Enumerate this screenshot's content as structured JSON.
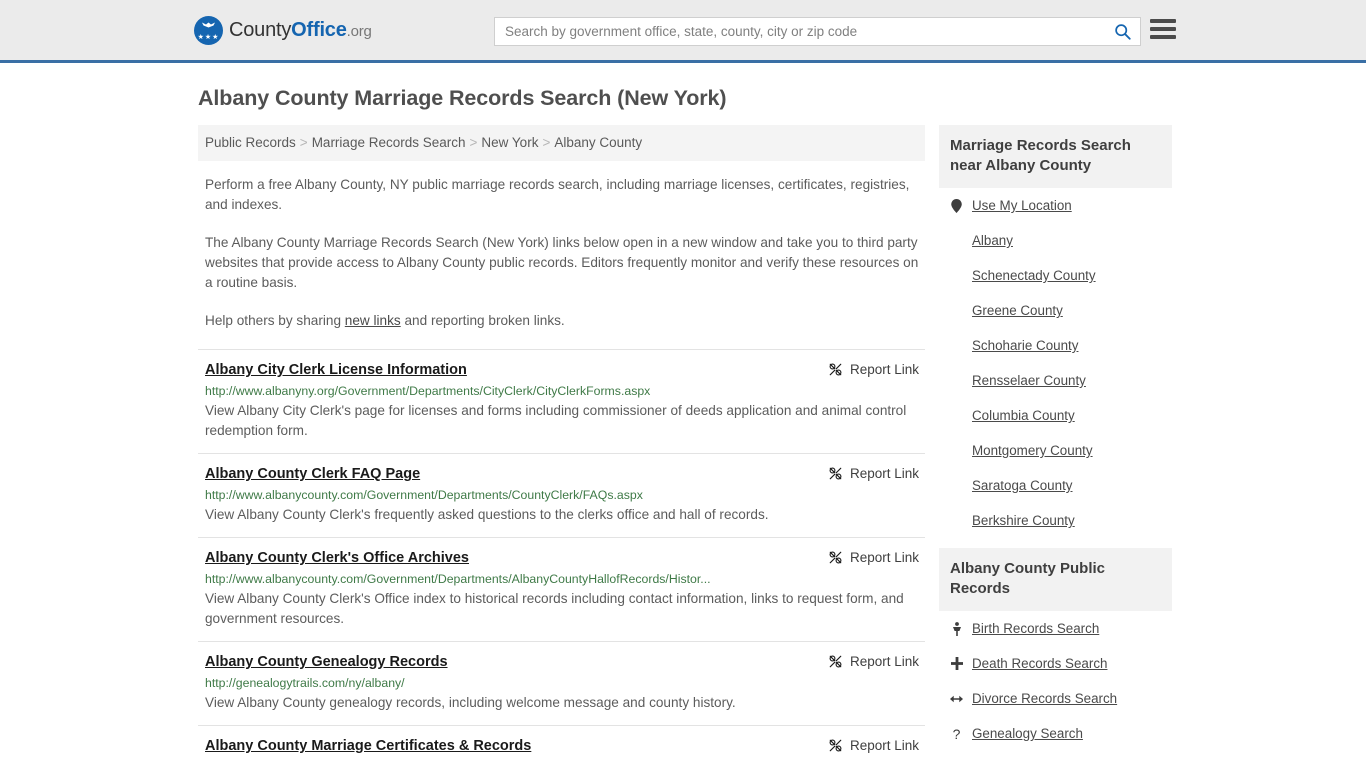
{
  "header": {
    "logo": {
      "part1": "County",
      "part2": "Office",
      "part3": ".org",
      "icon": "eagle-shield-logo"
    },
    "search": {
      "placeholder": "Search by government office, state, county, city or zip code",
      "value": "",
      "search_icon": "search-icon"
    },
    "menu_icon": "hamburger-menu-icon",
    "accent_color": "#3a6fa5"
  },
  "page_title": "Albany County Marriage Records Search (New York)",
  "breadcrumb": {
    "separator": ">",
    "items": [
      {
        "label": "Public Records"
      },
      {
        "label": "Marriage Records Search"
      },
      {
        "label": "New York"
      },
      {
        "label": "Albany County"
      }
    ]
  },
  "intro": {
    "p1": "Perform a free Albany County, NY public marriage records search, including marriage licenses, certificates, registries, and indexes.",
    "p2": "The Albany County Marriage Records Search (New York) links below open in a new window and take you to third party websites that provide access to Albany County public records. Editors frequently monitor and verify these resources on a routine basis.",
    "p3_before": "Help others by sharing ",
    "p3_link": "new links",
    "p3_after": " and reporting broken links."
  },
  "results": {
    "report_label": "Report Link",
    "report_icon": "broken-link-icon",
    "items": [
      {
        "title": "Albany City Clerk License Information",
        "url": "http://www.albanyny.org/Government/Departments/CityClerk/CityClerkForms.aspx",
        "description": "View Albany City Clerk's page for licenses and forms including commissioner of deeds application and animal control redemption form."
      },
      {
        "title": "Albany County Clerk FAQ Page",
        "url": "http://www.albanycounty.com/Government/Departments/CountyClerk/FAQs.aspx",
        "description": "View Albany County Clerk's frequently asked questions to the clerks office and hall of records."
      },
      {
        "title": "Albany County Clerk's Office Archives",
        "url": "http://www.albanycounty.com/Government/Departments/AlbanyCountyHallofRecords/Histor...",
        "description": "View Albany County Clerk's Office index to historical records including contact information, links to request form, and government resources."
      },
      {
        "title": "Albany County Genealogy Records",
        "url": "http://genealogytrails.com/ny/albany/",
        "description": "View Albany County genealogy records, including welcome message and county history."
      },
      {
        "title": "Albany County Marriage Certificates & Records",
        "url": "",
        "description": ""
      }
    ]
  },
  "sidebar": {
    "nearby": {
      "title": "Marriage Records Search near Albany County",
      "items": [
        {
          "label": "Use My Location",
          "icon": "map-pin-icon"
        },
        {
          "label": "Albany",
          "icon": ""
        },
        {
          "label": "Schenectady County",
          "icon": ""
        },
        {
          "label": "Greene County",
          "icon": ""
        },
        {
          "label": "Schoharie County",
          "icon": ""
        },
        {
          "label": "Rensselaer County",
          "icon": ""
        },
        {
          "label": "Columbia County",
          "icon": ""
        },
        {
          "label": "Montgomery County",
          "icon": ""
        },
        {
          "label": "Saratoga County",
          "icon": ""
        },
        {
          "label": "Berkshire County",
          "icon": ""
        }
      ]
    },
    "public_records": {
      "title": "Albany County Public Records",
      "items": [
        {
          "label": "Birth Records Search",
          "icon": "baby-icon"
        },
        {
          "label": "Death Records Search",
          "icon": "cross-icon"
        },
        {
          "label": "Divorce Records Search",
          "icon": "left-right-arrow-icon"
        },
        {
          "label": "Genealogy Search",
          "icon": "question-mark-icon"
        }
      ]
    }
  }
}
